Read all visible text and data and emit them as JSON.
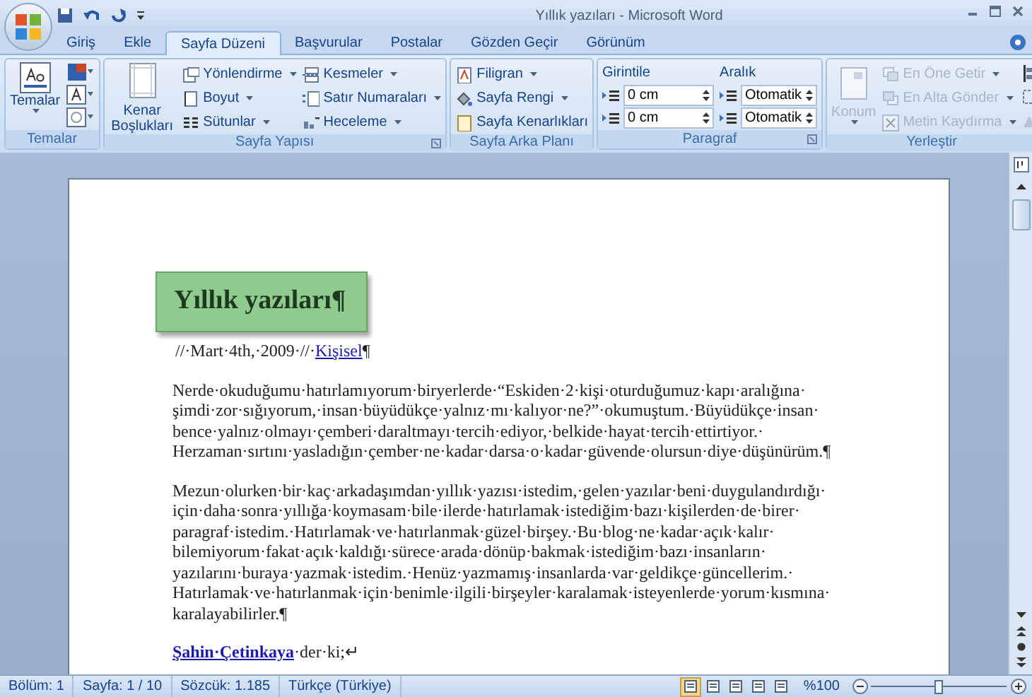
{
  "window": {
    "title": "Yıllık yazıları - Microsoft Word"
  },
  "tabs": [
    {
      "label": "Giriş",
      "selected": false
    },
    {
      "label": "Ekle",
      "selected": false
    },
    {
      "label": "Sayfa Düzeni",
      "selected": true
    },
    {
      "label": "Başvurular",
      "selected": false
    },
    {
      "label": "Postalar",
      "selected": false
    },
    {
      "label": "Gözden Geçir",
      "selected": false
    },
    {
      "label": "Görünüm",
      "selected": false
    }
  ],
  "ribbon": {
    "groups": [
      {
        "kind": "themes",
        "label": "Temalar",
        "button": "Temalar"
      },
      {
        "kind": "page_setup",
        "label": "Sayfa Yapısı",
        "large_button": "Kenar Boşlukları",
        "small_buttons": [
          {
            "label": "Yönlendirme",
            "dropdown": true
          },
          {
            "label": "Boyut",
            "dropdown": true
          },
          {
            "label": "Sütunlar",
            "dropdown": true
          },
          {
            "label": "Kesmeler",
            "dropdown": true
          },
          {
            "label": "Satır Numaraları",
            "dropdown": true
          },
          {
            "label": "Heceleme",
            "dropdown": true
          }
        ]
      },
      {
        "kind": "page_background",
        "label": "Sayfa Arka Planı",
        "small_buttons": [
          {
            "label": "Filigran",
            "dropdown": true
          },
          {
            "label": "Sayfa Rengi",
            "dropdown": true
          },
          {
            "label": "Sayfa Kenarlıkları",
            "dropdown": false
          }
        ]
      },
      {
        "kind": "paragraph",
        "label": "Paragraf",
        "indent_label": "Girintile",
        "indent_values": [
          "0 cm",
          "0 cm"
        ],
        "spacing_label": "Aralık",
        "spacing_values": [
          "Otomatik",
          "Otomatik"
        ]
      },
      {
        "kind": "arrange",
        "label": "Yerleştir",
        "large_button": {
          "label": "Konum",
          "disabled": true
        },
        "small_buttons": [
          {
            "label": "En Öne Getir",
            "dropdown": true,
            "disabled": true
          },
          {
            "label": "En Alta Gönder",
            "dropdown": true,
            "disabled": true
          },
          {
            "label": "Metin Kaydırma",
            "dropdown": true,
            "disabled": true
          }
        ]
      }
    ]
  },
  "document": {
    "heading": "Yıllık yazıları¶",
    "meta": {
      "text": "//·Mart·4th,·2009·//·",
      "link": "Kişisel",
      "end": "¶"
    },
    "paragraphs": [
      [
        "Nerde·okuduğumu·hatırlamıyorum·biryerlerde·“Eskiden·2·kişi·oturduğumuz·kapı·aralığına·",
        "şimdi·zor·sığıyorum,·insan·büyüdükçe·yalnız·mı·kalıyor·ne?”·okumuştum.·Büyüdükçe·insan·",
        "bence·yalnız·olmayı·çemberi·daraltmayı·tercih·ediyor,·belkide·hayat·tercih·ettirtiyor.·",
        "Herzaman·sırtını·yasladığın·çember·ne·kadar·darsa·o·kadar·güvende·olursun·diye·düşünürüm.¶"
      ],
      [
        "Mezun·olurken·bir·kaç·arkadaşımdan·yıllık·yazısı·istedim,·gelen·yazılar·beni·duygulandırdığı·",
        "için·daha·sonra·yıllığa·koymasam·bile·ilerde·hatırlamak·istediğim·bazı·kişilerden·de·birer·",
        "paragraf·istedim.·Hatırlamak·ve·hatırlanmak·güzel·birşey.·Bu·blog·ne·kadar·açık·kalır·",
        "bilemiyorum·fakat·açık·kaldığı·sürece·arada·dönüp·bakmak·istediğim·bazı·insanların·",
        "yazılarını·buraya·yazmak·istedim.·Henüz·yazmamış·insanlarda·var·geldikçe·güncellerim.·",
        "Hatırlamak·ve·hatırlanmak·için·benimle·ilgili·birşeyler·karalamak·isteyenlerde·yorum·kısmına·",
        "karalayabilirler.¶"
      ]
    ],
    "comment": {
      "author": "Şahin·Çetinkaya",
      "text": "·der·ki;↵"
    }
  },
  "status_bar": {
    "items": [
      "Bölüm: 1",
      "Sayfa: 1 / 10",
      "Sözcük: 1.185",
      "Türkçe (Türkiye)"
    ],
    "views": [
      {
        "selected": true
      },
      {
        "selected": false
      },
      {
        "selected": false
      },
      {
        "selected": false
      },
      {
        "selected": false
      }
    ],
    "zoom": "%100",
    "zoom_slider": {
      "level": 0.5
    }
  }
}
